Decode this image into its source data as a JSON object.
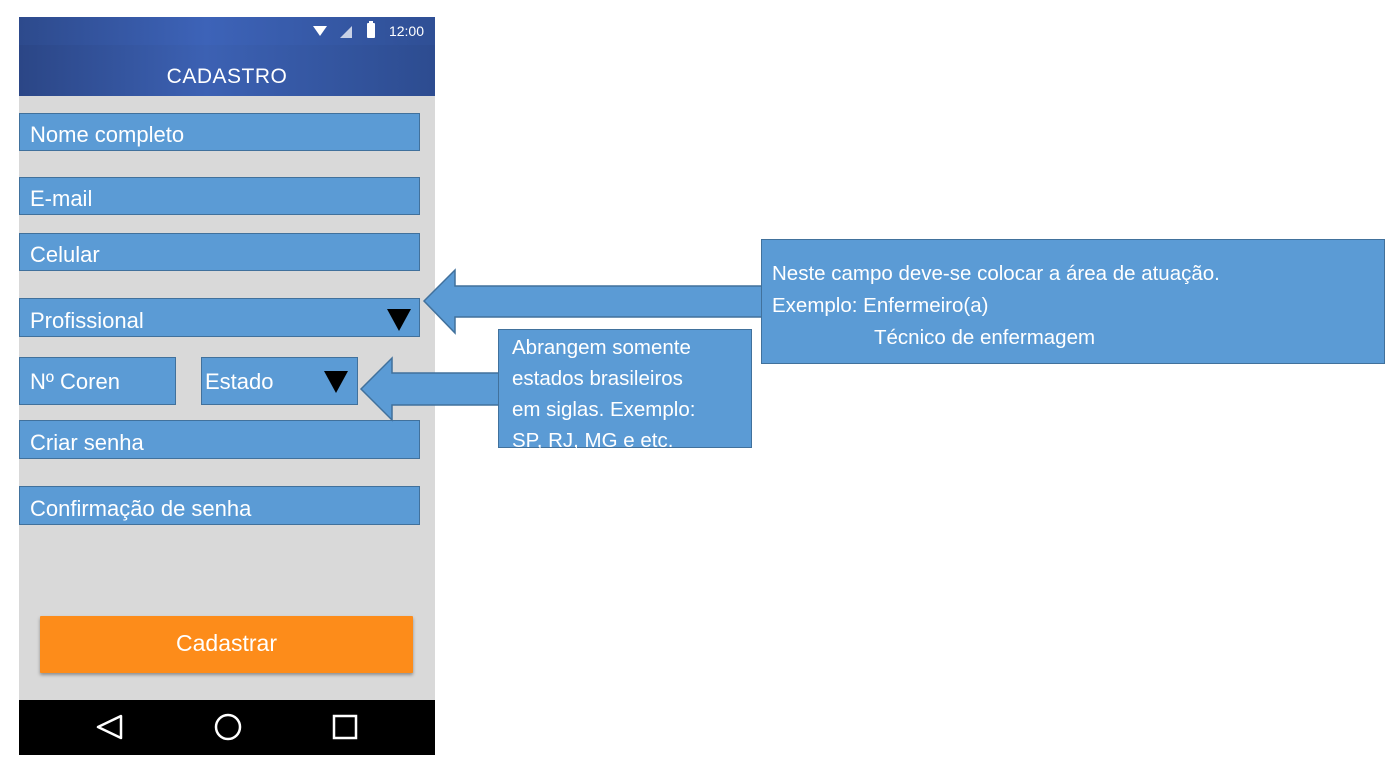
{
  "status_bar": {
    "time": "12:00"
  },
  "app_bar": {
    "title": "CADASTRO"
  },
  "form": {
    "full_name_placeholder": "Nome completo",
    "email_placeholder": "E-mail",
    "phone_placeholder": "Celular",
    "profession_placeholder": "Profissional",
    "coren_placeholder": "Nº Coren",
    "state_placeholder": "Estado",
    "password_placeholder": "Criar senha",
    "confirm_password_placeholder": "Confirmação de senha",
    "submit_label": "Cadastrar"
  },
  "annotations": {
    "profession_note": {
      "line1": "Neste campo deve-se colocar a área de atuação.",
      "line2": "Exemplo: Enfermeiro(a)",
      "line3": "Técnico de enfermagem"
    },
    "state_note": {
      "line1": "Abrangem somente",
      "line2": "estados brasileiros",
      "line3": "em siglas. Exemplo:",
      "line4": "SP, RJ, MG e etc."
    }
  },
  "colors": {
    "field_bg": "#5b9bd5",
    "app_bar": "#3c61b3",
    "button": "#fd8c1a",
    "screen_bg": "#d9d9d9"
  }
}
